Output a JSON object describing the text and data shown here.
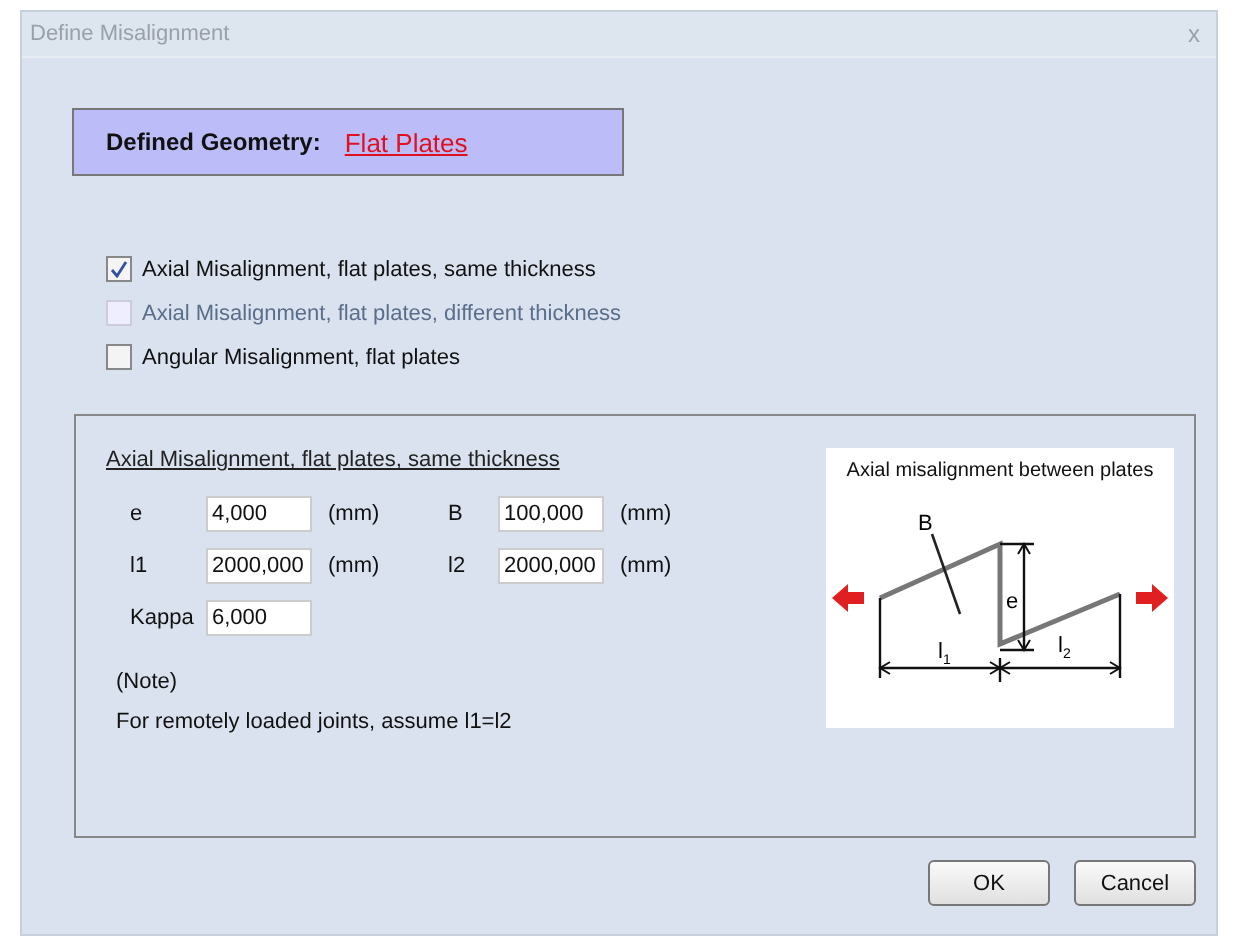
{
  "window": {
    "title": "Define Misalignment",
    "close": "x"
  },
  "geometry": {
    "label": "Defined Geometry:",
    "value": "Flat Plates"
  },
  "options": [
    {
      "label": "Axial Misalignment, flat plates, same thickness",
      "checked": true,
      "disabled": false
    },
    {
      "label": "Axial Misalignment, flat plates, different thickness",
      "checked": false,
      "disabled": true
    },
    {
      "label": "Angular Misalignment, flat plates",
      "checked": false,
      "disabled": false
    }
  ],
  "group": {
    "title": "Axial Misalignment, flat plates, same thickness",
    "rows": [
      [
        {
          "label": "e",
          "value": "4,000",
          "unit": "(mm)"
        },
        {
          "label": "B",
          "value": "100,000",
          "unit": "(mm)"
        }
      ],
      [
        {
          "label": "l1",
          "value": "2000,000",
          "unit": "(mm)"
        },
        {
          "label": "l2",
          "value": "2000,000",
          "unit": "(mm)"
        }
      ],
      [
        {
          "label": "Kappa",
          "value": "6,000"
        }
      ]
    ],
    "note_title": "(Note)",
    "note": "For remotely loaded joints, assume l1=l2",
    "diagram": {
      "title": "Axial misalignment between plates",
      "b": "B",
      "e": "e",
      "l1": {
        "base": "l",
        "sub": "1"
      },
      "l2": {
        "base": "l",
        "sub": "2"
      }
    }
  },
  "buttons": [
    "OK",
    "Cancel"
  ]
}
